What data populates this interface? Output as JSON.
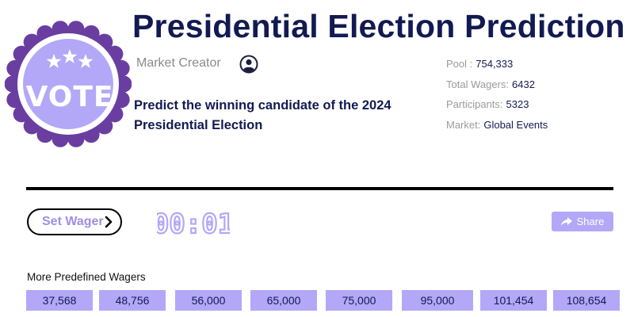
{
  "badge": {
    "text": "VOTE"
  },
  "header": {
    "title": "Presidential Election Prediction"
  },
  "creator": {
    "label": "Market Creator",
    "icon": "user-circle-icon"
  },
  "question": "Predict the winning candidate of the 2024 Presidential Election",
  "stats": {
    "pool": {
      "label": "Pool :",
      "value": "754,333"
    },
    "total_wagers": {
      "label": "Total Wagers:",
      "value": "6432"
    },
    "participants": {
      "label": "Participants:",
      "value": "5323"
    },
    "market": {
      "label": "Market:",
      "value": "Global Events"
    }
  },
  "actions": {
    "set_wager": "Set Wager",
    "share": "Share"
  },
  "timer": {
    "display": "00:01"
  },
  "predefined": {
    "label": "More Predefined Wagers",
    "wagers": [
      "37,568",
      "48,756",
      "56,000",
      "65,000",
      "75,000",
      "95,000",
      "101,454",
      "108,654"
    ]
  },
  "colors": {
    "accent": "#b3a8f7",
    "badge_ring": "#6a3ea1",
    "title": "#121a52"
  }
}
